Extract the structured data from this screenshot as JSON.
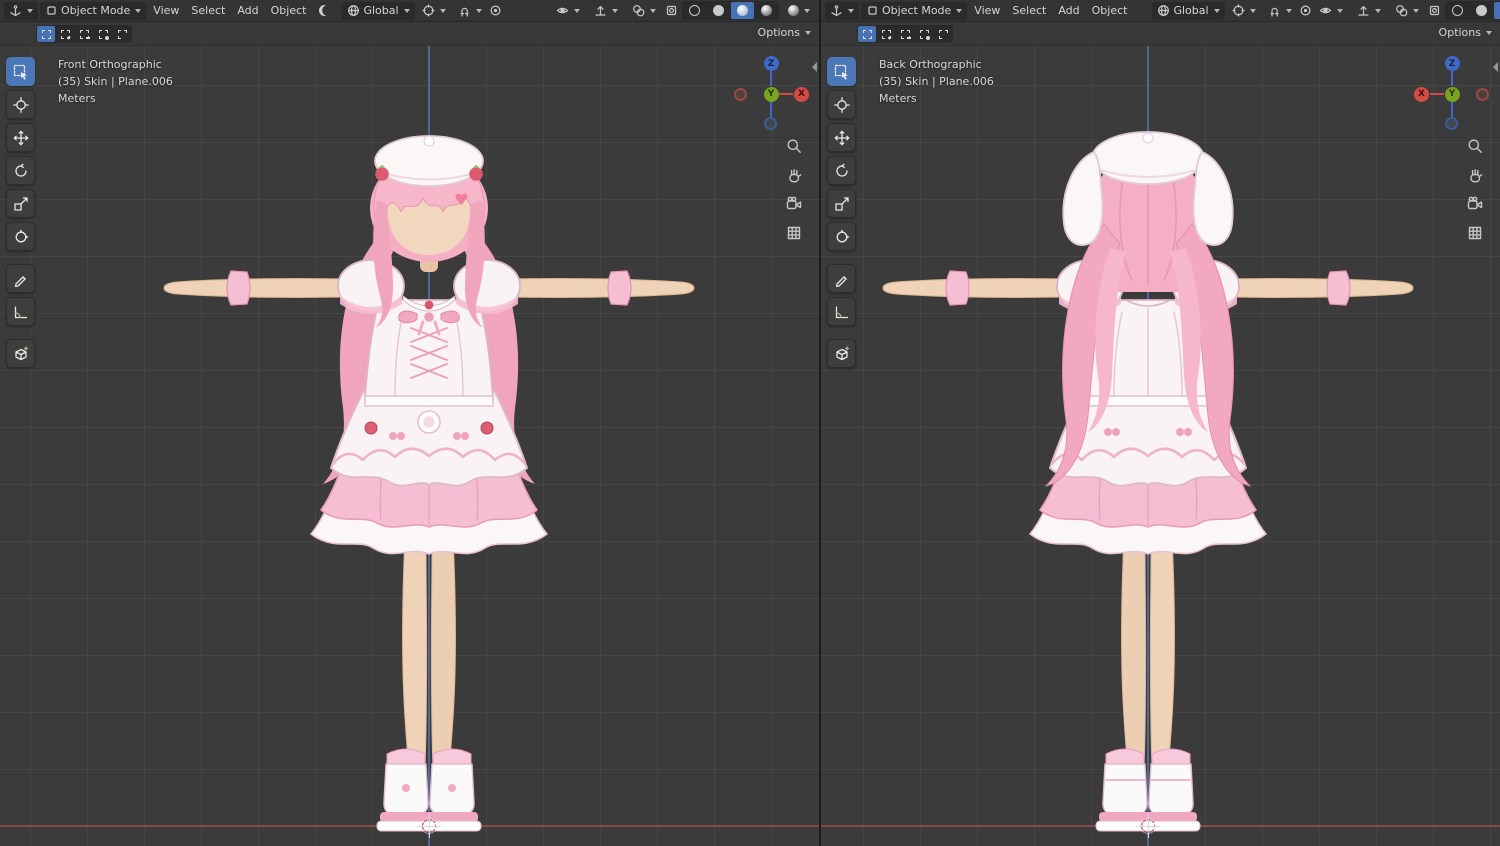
{
  "app": {
    "name": "Blender",
    "layout": "dual 3D viewport (front / back orthographic)",
    "accent_color": "#4772b3"
  },
  "colors": {
    "header_bg": "#343434",
    "viewport_bg": "#3b3b3b",
    "grid_line": "#454545",
    "floor_line_red": "#8d4a46",
    "z_axis_line_blue": "#51699c",
    "gizmo_x": "#d54c44",
    "gizmo_y": "#79a41f",
    "gizmo_z": "#3f69c8",
    "tool_active": "#4b77b9",
    "model_hair_pink": "#f4afc4",
    "model_skin": "#efd2b8",
    "model_dress_white": "#f8f3f5",
    "model_frill_pink": "#f6bed3",
    "model_accent_red": "#d9536a"
  },
  "header": {
    "editor_icon": "editor-type-3d-viewport-icon",
    "mode_label": "Object Mode",
    "menus": [
      "View",
      "Select",
      "Add",
      "Object"
    ],
    "falloff_icon": "proportional-falloff-crescent-icon",
    "orientation_label": "Global",
    "icons": [
      "transform-orientation-icon",
      "pivot-point-icon",
      "snap-magnet-icon",
      "proportional-editing-icon",
      "object-visibility-icon",
      "gizmos-icon",
      "overlays-icon",
      "xray-icon",
      "shading-wireframe-icon",
      "shading-solid-icon",
      "shading-material-icon",
      "shading-rendered-icon",
      "shading-dropdown-icon"
    ],
    "active_shading": "material-preview"
  },
  "tool_settings": {
    "select_modes": [
      "select-set",
      "select-extend",
      "select-subtract",
      "select-invert",
      "select-intersect"
    ],
    "active_select_mode": "select-set",
    "options_label": "Options"
  },
  "toolbar": {
    "tools": [
      "tweak-select",
      "cursor",
      "move",
      "rotate",
      "scale",
      "transform",
      "annotate",
      "measure",
      "add-cube"
    ],
    "active_tool": "tweak-select"
  },
  "panels": [
    {
      "view_label": "Front Orthographic",
      "object_label": "(35) Skin | Plane.006",
      "units_label": "Meters",
      "gizmo": {
        "up": "Z",
        "center": "Y",
        "side": "X",
        "x_position": "right"
      },
      "scene_object": "chibi anime girl, pink twin-tail hair, white beret, white-pink frilled dress, T-pose, front view"
    },
    {
      "view_label": "Back Orthographic",
      "object_label": "(35) Skin | Plane.006",
      "units_label": "Meters",
      "gizmo": {
        "up": "Z",
        "center": "Y",
        "side": "X",
        "x_position": "left"
      },
      "scene_object": "chibi anime girl, pink twin-tail hair, bunny-ear hat, white-pink frilled dress, T-pose, back view"
    }
  ]
}
